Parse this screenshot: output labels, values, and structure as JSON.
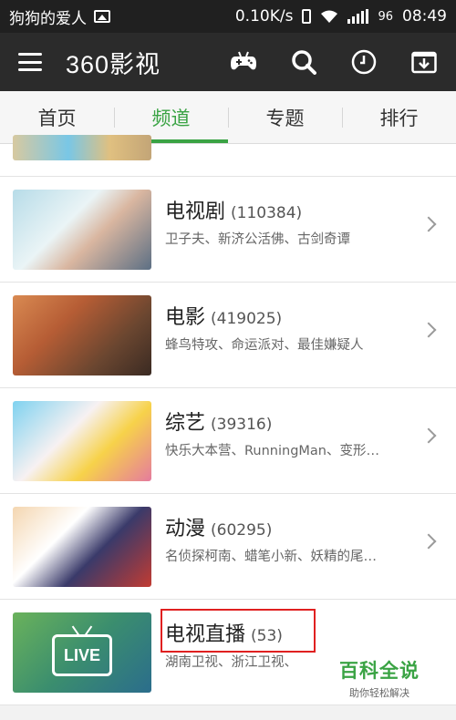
{
  "status_bar": {
    "notification_text": "狗狗的爱人",
    "net_speed": "0.10K/s",
    "signal_label": "96",
    "time": "08:49"
  },
  "header": {
    "logo": "360影视",
    "icons": [
      "menu-icon",
      "gamepad-icon",
      "search-icon",
      "history-clock-icon",
      "download-icon"
    ]
  },
  "tabs": [
    {
      "label": "首页",
      "active": false
    },
    {
      "label": "频道",
      "active": true
    },
    {
      "label": "专题",
      "active": false
    },
    {
      "label": "排行",
      "active": false
    }
  ],
  "channels": [
    {
      "title": "电视剧",
      "count": "(110384)",
      "subtitle": "卫子夫、新济公活佛、古剑奇谭"
    },
    {
      "title": "电影",
      "count": "(419025)",
      "subtitle": "蜂鸟特攻、命运派对、最佳嫌疑人"
    },
    {
      "title": "综艺",
      "count": "(39316)",
      "subtitle": "快乐大本营、RunningMan、变形…"
    },
    {
      "title": "动漫",
      "count": "(60295)",
      "subtitle": "名侦探柯南、蜡笔小新、妖精的尾…"
    },
    {
      "title": "电视直播",
      "count": "(53)",
      "subtitle": "湖南卫视、浙江卫视、",
      "thumb_text": "LIVE"
    }
  ],
  "watermark": {
    "title": "百科全说",
    "subtitle": "助你轻松解决"
  },
  "colors": {
    "accent": "#3aa344",
    "header_bg": "#2b2b2b",
    "highlight": "#e02020"
  }
}
